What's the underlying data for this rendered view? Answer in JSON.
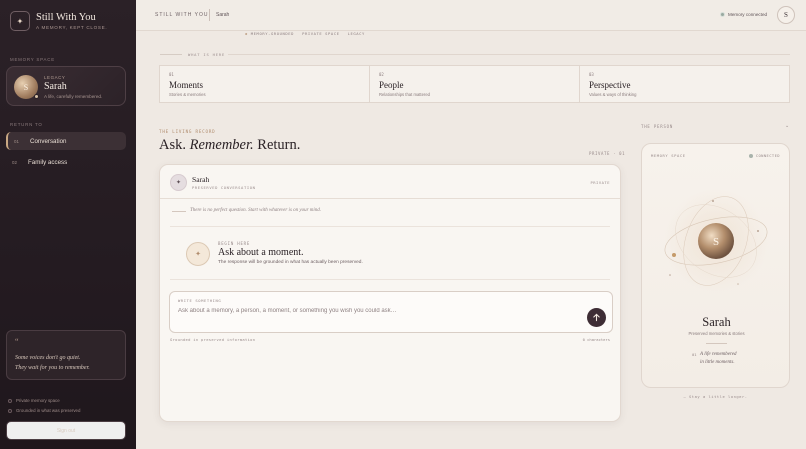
{
  "brand": {
    "mark": "✦",
    "title": "Still With You",
    "subtitle": "A MEMORY, KEPT CLOSE."
  },
  "sidebar": {
    "memory_space_label": "MEMORY SPACE",
    "legacy": {
      "tag": "LEGACY",
      "name": "Sarah",
      "initial": "S",
      "description": "A life, carefully remembered."
    },
    "return_label": "RETURN TO",
    "nav": [
      {
        "num": "01",
        "label": "Conversation",
        "active": true
      },
      {
        "num": "02",
        "label": "Family access",
        "active": false
      }
    ],
    "quote": {
      "mark": "“",
      "line1": "Some voices don't go quiet.",
      "line2": "They wait for you to remember."
    },
    "notes": [
      "Private memory space",
      "Grounded in what was preserved"
    ],
    "signout_label": "Sign out"
  },
  "topbar": {
    "app_name": "STILL WITH YOU",
    "person": "Sarah",
    "memory_status": "Memory connected",
    "avatar_initial": "S"
  },
  "subnav": [
    "MEMORY-GROUNDED",
    "PRIVATE SPACE",
    "LEGACY"
  ],
  "what_is_here": {
    "label": "WHAT IS HERE",
    "cards": [
      {
        "num": "01",
        "title": "Moments",
        "desc": "Stories & memories"
      },
      {
        "num": "02",
        "title": "People",
        "desc": "Relationships that mattered"
      },
      {
        "num": "03",
        "title": "Perspective",
        "desc": "Values & ways of thinking"
      }
    ]
  },
  "living_record": {
    "label": "THE LIVING RECORD",
    "headline_a": "Ask.",
    "headline_b": "Remember.",
    "headline_c": "Return.",
    "private_tag": "PRIVATE · 01"
  },
  "conversation": {
    "avatar": "✦",
    "name": "Sarah",
    "subtitle": "PRESERVED CONVERSATION",
    "private": "PRIVATE",
    "hint": "There is no perfect question. Start with whatever is on your mind.",
    "begin": {
      "label": "BEGIN HERE",
      "icon": "✦",
      "title": "Ask about a moment.",
      "desc": "The response will be grounded in what has actually been preserved."
    },
    "input": {
      "label": "WRITE SOMETHING",
      "placeholder": "Ask about a memory, a person, a moment, or something you wish you could ask…",
      "send_icon": "arrow-up-icon"
    },
    "grounded_note": "Grounded in preserved information",
    "char_count": "0 characters"
  },
  "person_panel": {
    "label": "THE PERSON",
    "chevron": "⌄",
    "space_label": "MEMORY SPACE",
    "status": "CONNECTED",
    "initial": "S",
    "name": "Sarah",
    "desc": "Preserved memories & stories",
    "quote_num": "01",
    "quote_line1": "A life remembered",
    "quote_line2": "in little moments.",
    "stay_note": "— Stay a little longer."
  }
}
